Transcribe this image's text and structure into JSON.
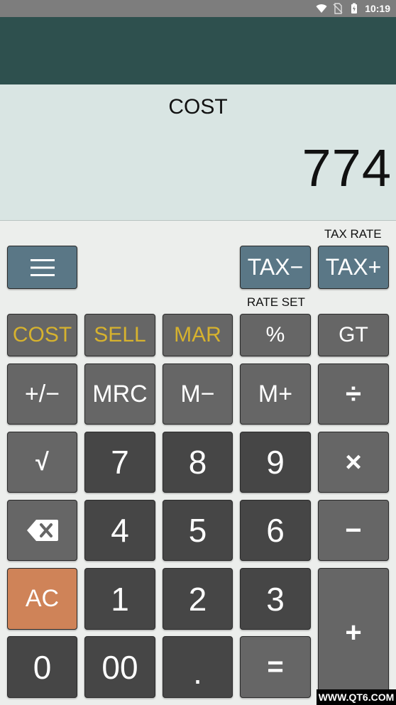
{
  "status_bar": {
    "time": "10:19",
    "icons": [
      "wifi-icon",
      "no-sim-icon",
      "battery-icon"
    ]
  },
  "display": {
    "mode": "COST",
    "value": "774"
  },
  "labels": {
    "tax_rate": "TAX RATE",
    "rate_set": "RATE SET"
  },
  "buttons": {
    "menu": "menu-icon",
    "tax_minus": "TAX−",
    "tax_plus": "TAX+",
    "cost": "COST",
    "sell": "SELL",
    "mar": "MAR",
    "percent": "%",
    "gt": "GT",
    "plus_minus": "+/−",
    "mrc": "MRC",
    "m_minus": "M−",
    "m_plus": "M+",
    "divide": "÷",
    "sqrt": "√",
    "seven": "7",
    "eight": "8",
    "nine": "9",
    "multiply": "×",
    "backspace": "backspace-icon",
    "four": "4",
    "five": "5",
    "six": "6",
    "minus": "−",
    "ac": "AC",
    "one": "1",
    "two": "2",
    "three": "3",
    "plus": "+",
    "zero": "0",
    "double_zero": "00",
    "dot": ".",
    "equals": "="
  },
  "watermark": "WWW.QT6.COM",
  "colors": {
    "app_bar": "#2e504e",
    "display_bg": "#d9e5e3",
    "key_dark": "#464646",
    "key_mid": "#666666",
    "key_blue": "#5a7786",
    "key_orange": "#cf8358",
    "gold_text": "#d6b22e"
  }
}
